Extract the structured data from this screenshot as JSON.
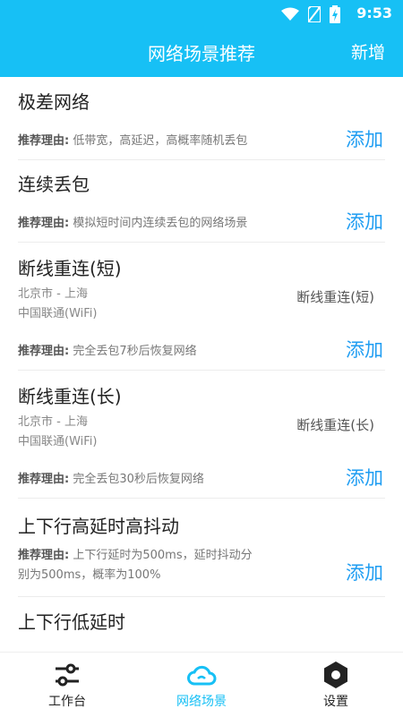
{
  "status": {
    "time": "9:53"
  },
  "appbar": {
    "title": "网络场景推荐",
    "action": "新增"
  },
  "reason_label": "推荐理由:",
  "add_label": "添加",
  "items": [
    {
      "name": "极差网络",
      "reason": "低带宽，高延迟，高概率随机丢包"
    },
    {
      "name": "连续丢包",
      "reason": "模拟短时间内连续丢包的网络场景"
    },
    {
      "name": "断线重连(短)",
      "route": "北京市 - 上海",
      "carrier": "中国联通(WiFi)",
      "tag": "断线重连(短)",
      "reason": "完全丢包7秒后恢复网络"
    },
    {
      "name": "断线重连(长)",
      "route": "北京市 - 上海",
      "carrier": "中国联通(WiFi)",
      "tag": "断线重连(长)",
      "reason": "完全丢包30秒后恢复网络"
    },
    {
      "name": "上下行高延时高抖动",
      "reason_line1": "上下行延时为500ms，延时抖动分",
      "reason_line2": "别为500ms，概率为100%"
    },
    {
      "name": "上下行低延时"
    }
  ],
  "tabs": [
    {
      "label": "工作台",
      "icon": "sliders-icon"
    },
    {
      "label": "网络场景",
      "icon": "cloud-icon"
    },
    {
      "label": "设置",
      "icon": "settings-icon"
    }
  ],
  "colors": {
    "primary": "#17c0f5",
    "link": "#1f9df2"
  }
}
